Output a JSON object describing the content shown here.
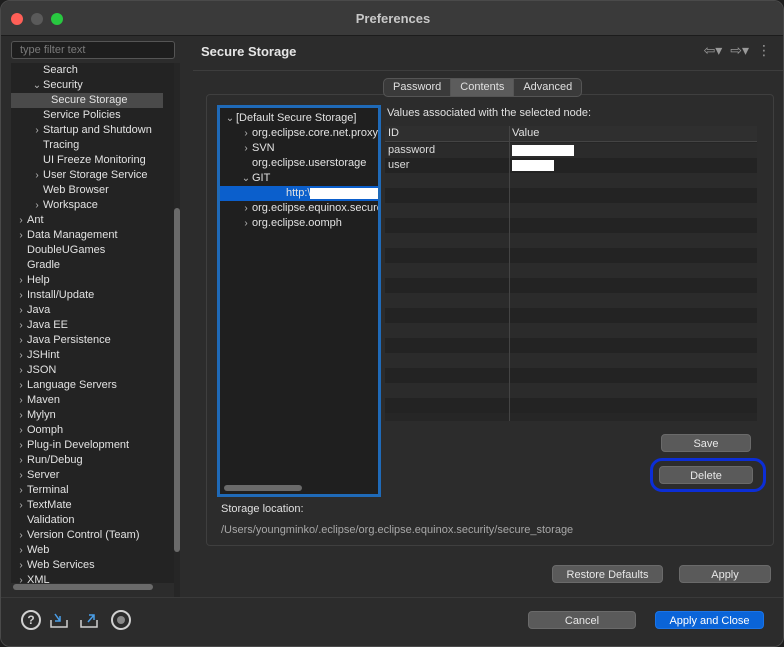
{
  "window": {
    "title": "Preferences"
  },
  "filter": {
    "placeholder": "type filter text"
  },
  "left_tree": {
    "items": [
      {
        "label": "Search",
        "indent": 2,
        "chevron": ""
      },
      {
        "label": "Security",
        "indent": 2,
        "chevron": "open"
      },
      {
        "label": "Secure Storage",
        "indent": 3,
        "chevron": "",
        "selected": true
      },
      {
        "label": "Service Policies",
        "indent": 2,
        "chevron": ""
      },
      {
        "label": "Startup and Shutdown",
        "indent": 2,
        "chevron": "closed"
      },
      {
        "label": "Tracing",
        "indent": 2,
        "chevron": ""
      },
      {
        "label": "UI Freeze Monitoring",
        "indent": 2,
        "chevron": ""
      },
      {
        "label": "User Storage Service",
        "indent": 2,
        "chevron": "closed"
      },
      {
        "label": "Web Browser",
        "indent": 2,
        "chevron": ""
      },
      {
        "label": "Workspace",
        "indent": 2,
        "chevron": "closed"
      },
      {
        "label": "Ant",
        "indent": 0,
        "chevron": "closed"
      },
      {
        "label": "Data Management",
        "indent": 0,
        "chevron": "closed"
      },
      {
        "label": "DoubleUGames",
        "indent": 0,
        "chevron": ""
      },
      {
        "label": "Gradle",
        "indent": 0,
        "chevron": ""
      },
      {
        "label": "Help",
        "indent": 0,
        "chevron": "closed"
      },
      {
        "label": "Install/Update",
        "indent": 0,
        "chevron": "closed"
      },
      {
        "label": "Java",
        "indent": 0,
        "chevron": "closed"
      },
      {
        "label": "Java EE",
        "indent": 0,
        "chevron": "closed"
      },
      {
        "label": "Java Persistence",
        "indent": 0,
        "chevron": "closed"
      },
      {
        "label": "JSHint",
        "indent": 0,
        "chevron": "closed"
      },
      {
        "label": "JSON",
        "indent": 0,
        "chevron": "closed"
      },
      {
        "label": "Language Servers",
        "indent": 0,
        "chevron": "closed"
      },
      {
        "label": "Maven",
        "indent": 0,
        "chevron": "closed"
      },
      {
        "label": "Mylyn",
        "indent": 0,
        "chevron": "closed"
      },
      {
        "label": "Oomph",
        "indent": 0,
        "chevron": "closed"
      },
      {
        "label": "Plug-in Development",
        "indent": 0,
        "chevron": "closed"
      },
      {
        "label": "Run/Debug",
        "indent": 0,
        "chevron": "closed"
      },
      {
        "label": "Server",
        "indent": 0,
        "chevron": "closed"
      },
      {
        "label": "Terminal",
        "indent": 0,
        "chevron": "closed"
      },
      {
        "label": "TextMate",
        "indent": 0,
        "chevron": "closed"
      },
      {
        "label": "Validation",
        "indent": 0,
        "chevron": ""
      },
      {
        "label": "Version Control (Team)",
        "indent": 0,
        "chevron": "closed"
      },
      {
        "label": "Web",
        "indent": 0,
        "chevron": "closed"
      },
      {
        "label": "Web Services",
        "indent": 0,
        "chevron": "closed"
      },
      {
        "label": "XML",
        "indent": 0,
        "chevron": "closed"
      }
    ]
  },
  "page": {
    "title": "Secure Storage"
  },
  "tabs": [
    {
      "label": "Password",
      "active": false
    },
    {
      "label": "Contents",
      "active": true
    },
    {
      "label": "Advanced",
      "active": false
    }
  ],
  "node_tree": {
    "items": [
      {
        "label": "[Default Secure Storage]",
        "indent": 0,
        "chevron": "open"
      },
      {
        "label": "org.eclipse.core.net.proxy",
        "indent": 1,
        "chevron": "closed"
      },
      {
        "label": "SVN",
        "indent": 1,
        "chevron": "closed"
      },
      {
        "label": "org.eclipse.userstorage",
        "indent": 1,
        "chevron": ""
      },
      {
        "label": "GIT",
        "indent": 1,
        "chevron": "open"
      },
      {
        "label": "http:\\",
        "indent": 2,
        "chevron": "",
        "selected": true,
        "redacted": true
      },
      {
        "label": "org.eclipse.equinox.secure",
        "indent": 1,
        "chevron": "closed"
      },
      {
        "label": "org.eclipse.oomph",
        "indent": 1,
        "chevron": "closed"
      }
    ]
  },
  "values": {
    "label": "Values associated with the selected node:",
    "columns": [
      "ID",
      "Value"
    ],
    "rows": [
      {
        "id": "password"
      },
      {
        "id": "user"
      }
    ]
  },
  "buttons": {
    "save": "Save",
    "delete": "Delete",
    "restore_defaults": "Restore Defaults",
    "apply": "Apply",
    "cancel": "Cancel",
    "apply_close": "Apply and Close"
  },
  "storage": {
    "label": "Storage location:",
    "path": "/Users/youngminko/.eclipse/org.eclipse.equinox.security/secure_storage"
  },
  "colors": {
    "accent": "#0a64d8",
    "selection": "#0b5fcc",
    "focus_ring": "#0c2ed6",
    "tree_border": "#1f6ab8"
  }
}
